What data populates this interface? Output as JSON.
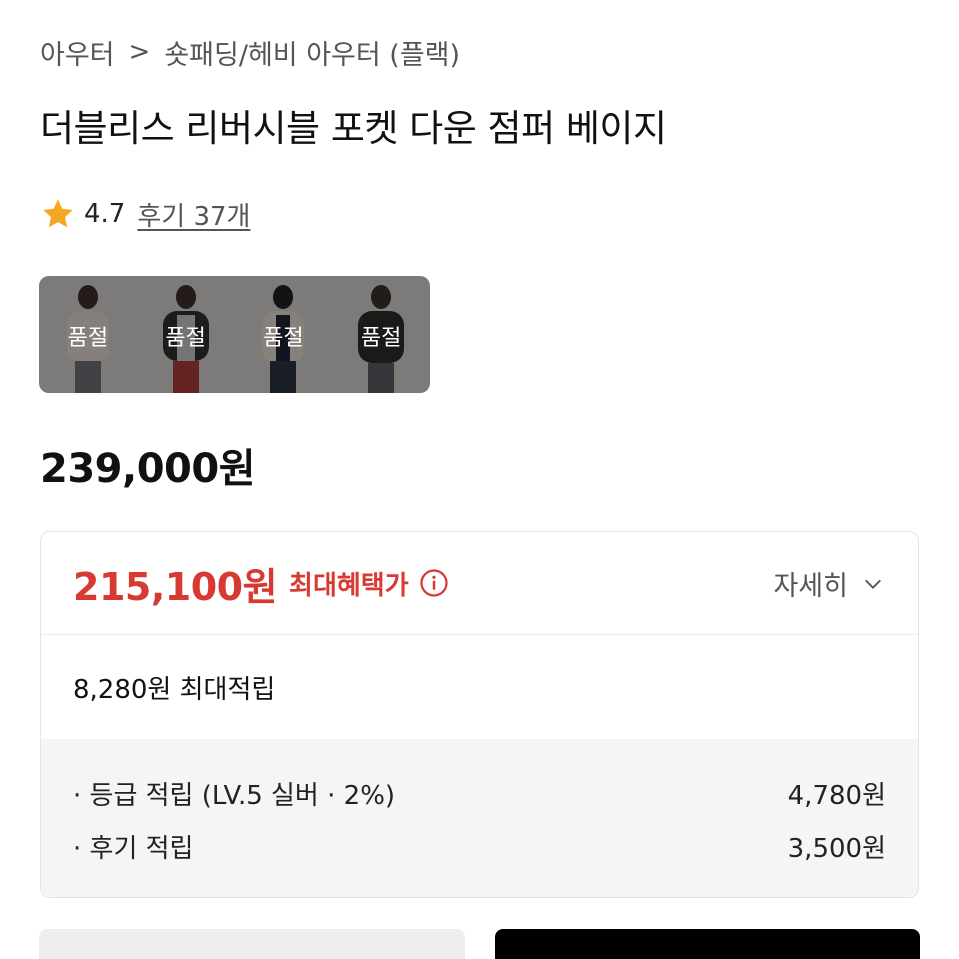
{
  "breadcrumb": {
    "root": "아우터",
    "separator": ">",
    "category": "숏패딩/헤비 아우터 (플랙)"
  },
  "product": {
    "title": "더블리스 리버시블 포켓 다운 점퍼 베이지",
    "rating": "4.7",
    "reviews": "후기 37개",
    "price": "239,000원"
  },
  "color_options": [
    {
      "label": "품절",
      "jacket_color": "#d9cfc8"
    },
    {
      "label": "품절",
      "jacket_color": "#2e2e2c"
    },
    {
      "label": "품절",
      "jacket_color": "#d8d2c3"
    },
    {
      "label": "품절",
      "jacket_color": "#2a2a28"
    }
  ],
  "benefit": {
    "max_price": "215,100원",
    "max_price_label": "최대혜택가",
    "detail_label": "자세히",
    "max_points": "8,280원 최대적립",
    "rows": [
      {
        "label": "· 등급 적립 (LV.5 실버 · 2%)",
        "value": "4,780원"
      },
      {
        "label": "· 후기 적립",
        "value": "3,500원"
      }
    ]
  },
  "colors": {
    "accent_red": "#d73a32",
    "star": "#f5a623",
    "text_primary": "#111111",
    "text_secondary": "#555555"
  },
  "icons": {
    "breadcrumb_separator": "chevron-right-icon",
    "rating": "star-icon",
    "info": "info-circle-icon",
    "detail": "chevron-down-icon"
  }
}
